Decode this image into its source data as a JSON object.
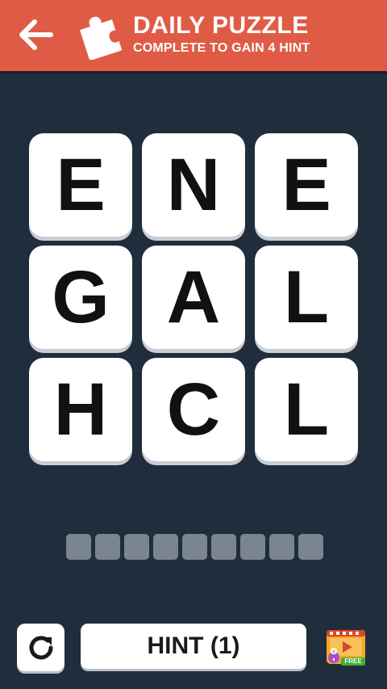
{
  "header": {
    "title": "DAILY PUZZLE",
    "subtitle": "COMPLETE TO GAIN 4 HINT",
    "back_icon": "arrow-left-icon",
    "puzzle_icon": "puzzle-piece-icon"
  },
  "grid": {
    "letters": [
      "E",
      "N",
      "E",
      "G",
      "A",
      "L",
      "H",
      "C",
      "L"
    ]
  },
  "answer": {
    "slot_count": 9
  },
  "footer": {
    "refresh_icon": "refresh-icon",
    "hint_label": "HINT (1)",
    "free_badge": "FREE",
    "free_icon": "free-video-icon"
  },
  "colors": {
    "header": "#e05b45",
    "background": "#1f2d3d",
    "tile": "#ffffff",
    "slot": "#7b8590",
    "free_green": "#3fae36",
    "free_orange": "#f5a623"
  }
}
